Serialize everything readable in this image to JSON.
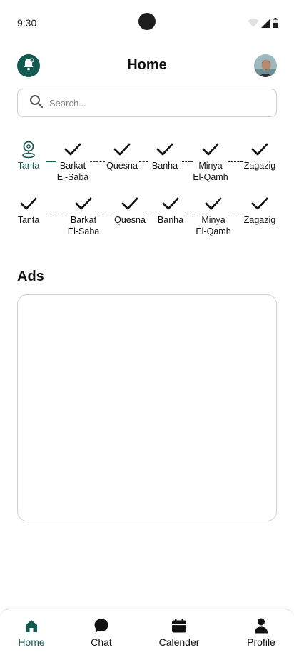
{
  "status": {
    "time": "9:30"
  },
  "header": {
    "title": "Home"
  },
  "search": {
    "placeholder": "Search..."
  },
  "stepper_rows": [
    {
      "steps": [
        {
          "label": "Tanta",
          "state": "current",
          "icon": "location-pin-icon"
        },
        {
          "label": "Barkat\nEl-Saba",
          "state": "done",
          "icon": "check-icon"
        },
        {
          "label": "Quesna",
          "state": "done",
          "icon": "check-icon"
        },
        {
          "label": "Banha",
          "state": "done",
          "icon": "check-icon"
        },
        {
          "label": "Minya\nEl-Qamh",
          "state": "done",
          "icon": "check-icon"
        },
        {
          "label": "Zagazig",
          "state": "done",
          "icon": "check-icon"
        }
      ]
    },
    {
      "steps": [
        {
          "label": "Tanta",
          "state": "done",
          "icon": "check-icon"
        },
        {
          "label": "Barkat\nEl-Saba",
          "state": "done",
          "icon": "check-icon"
        },
        {
          "label": "Quesna",
          "state": "done",
          "icon": "check-icon"
        },
        {
          "label": "Banha",
          "state": "done",
          "icon": "check-icon"
        },
        {
          "label": "Minya\nEl-Qamh",
          "state": "done",
          "icon": "check-icon"
        },
        {
          "label": "Zagazig",
          "state": "done",
          "icon": "check-icon"
        }
      ]
    }
  ],
  "ads": {
    "title": "Ads"
  },
  "bottom_nav": {
    "items": [
      {
        "label": "Home",
        "icon": "home-icon",
        "active": true
      },
      {
        "label": "Chat",
        "icon": "chat-bubble-icon",
        "active": false
      },
      {
        "label": "Calender",
        "icon": "calendar-icon",
        "active": false
      },
      {
        "label": "Profile",
        "icon": "person-icon",
        "active": false
      }
    ]
  },
  "colors": {
    "accent": "#145a50",
    "text": "#111111",
    "border": "#cfcfcf"
  }
}
